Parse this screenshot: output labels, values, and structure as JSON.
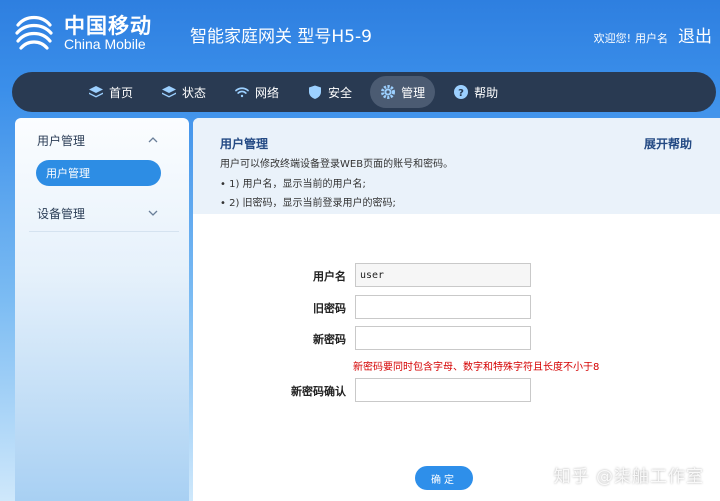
{
  "brand": {
    "name_cn": "中国移动",
    "name_en": "China Mobile"
  },
  "header": {
    "title": "智能家庭网关 型号H5-9",
    "welcome": "欢迎您!",
    "username": "用户名",
    "logout": "退出"
  },
  "nav": {
    "items": [
      {
        "label": "首页",
        "icon": "layers-icon"
      },
      {
        "label": "状态",
        "icon": "layers-icon"
      },
      {
        "label": "网络",
        "icon": "wifi-icon"
      },
      {
        "label": "安全",
        "icon": "shield-icon"
      },
      {
        "label": "管理",
        "icon": "gear-icon",
        "active": true
      },
      {
        "label": "帮助",
        "icon": "help-icon"
      }
    ]
  },
  "sidebar": {
    "groups": [
      {
        "label": "用户管理",
        "expanded": true,
        "items": [
          {
            "label": "用户管理",
            "active": true
          }
        ]
      },
      {
        "label": "设备管理",
        "expanded": false
      }
    ]
  },
  "help": {
    "title": "用户管理",
    "expand_label": "展开帮助",
    "lines": [
      "用户可以修改终端设备登录WEB页面的账号和密码。",
      "• 1) 用户名，显示当前的用户名;",
      "• 2) 旧密码，显示当前登录用户的密码;"
    ]
  },
  "form": {
    "username_label": "用户名",
    "username_value": "user",
    "old_password_label": "旧密码",
    "old_password_value": "",
    "new_password_label": "新密码",
    "new_password_value": "",
    "password_hint": "新密码要同时包含字母、数字和特殊字符且长度不小于8",
    "confirm_label": "新密码确认",
    "confirm_value": "",
    "submit_label": "确定"
  },
  "watermark": "知乎 @柒舳工作室",
  "colors": {
    "accent": "#2e8fea",
    "nav_bg": "#293a52",
    "warning": "#d40000",
    "help_title": "#244a84"
  }
}
